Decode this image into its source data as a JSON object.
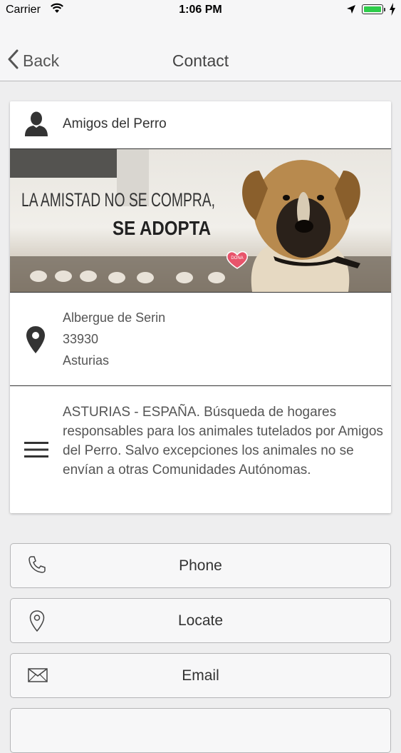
{
  "status_bar": {
    "carrier": "Carrier",
    "time": "1:06 PM"
  },
  "nav": {
    "back_label": "Back",
    "title": "Contact"
  },
  "contact": {
    "name": "Amigos del Perro",
    "banner": {
      "line1": "LA AMISTAD NO SE COMPRA,",
      "line2": "SE ADOPTA",
      "badge": "DONA"
    },
    "address": {
      "line1": "Albergue de Serin",
      "line2": "33930",
      "line3": "Asturias"
    },
    "description": "ASTURIAS - ESPAÑA. Búsqueda de hogares responsables para los animales tutelados por Amigos del Perro. Salvo excepciones los animales no se envían a otras Comunidades Autónomas."
  },
  "actions": {
    "phone_label": "Phone",
    "locate_label": "Locate",
    "email_label": "Email"
  },
  "colors": {
    "background": "#eeeeef",
    "battery": "#2ecc4a",
    "heart": "#e8546b"
  }
}
